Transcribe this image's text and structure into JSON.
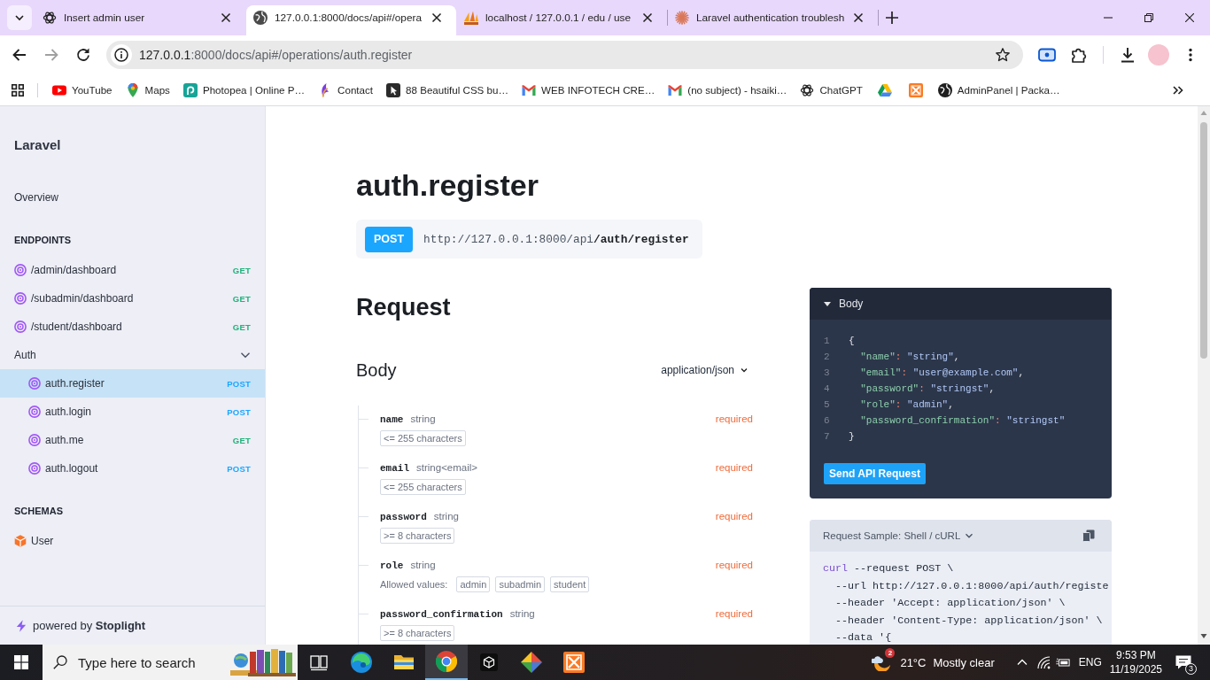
{
  "window": {
    "tabs": [
      {
        "title": "Insert admin user",
        "selected": false
      },
      {
        "title": "127.0.0.1:8000/docs/api#/opera",
        "selected": true
      },
      {
        "title": "localhost / 127.0.0.1 / edu / use",
        "selected": false
      },
      {
        "title": "Laravel authentication troublesh",
        "selected": false
      }
    ]
  },
  "address_bar": {
    "host": "127.0.0.1",
    "path": ":8000/docs/api#/operations/auth.register"
  },
  "bookmarks": [
    {
      "kind": "link",
      "label": "YouTube"
    },
    {
      "kind": "link",
      "label": "Maps"
    },
    {
      "kind": "link",
      "label": "Photopea | Online P…"
    },
    {
      "kind": "link",
      "label": "Contact"
    },
    {
      "kind": "link",
      "label": "88 Beautiful CSS bu…"
    },
    {
      "kind": "link",
      "label": "WEB INFOTECH CRE…"
    },
    {
      "kind": "link",
      "label": "(no subject) - hsaiki…"
    },
    {
      "kind": "link",
      "label": "ChatGPT"
    },
    {
      "kind": "icon"
    },
    {
      "kind": "icon"
    },
    {
      "kind": "link",
      "label": "AdminPanel | Packa…"
    }
  ],
  "sidebar": {
    "title": "Laravel",
    "overview": {
      "label": "Overview",
      "selected": false
    },
    "sections": [
      {
        "heading": "ENDPOINTS",
        "items": [
          {
            "kind": "endpoint",
            "label": "/admin/dashboard",
            "method": "GET",
            "color": "#1eb27a",
            "selected": false
          },
          {
            "kind": "endpoint",
            "label": "/subadmin/dashboard",
            "method": "GET",
            "color": "#1eb27a",
            "selected": false
          },
          {
            "kind": "endpoint",
            "label": "/student/dashboard",
            "method": "GET",
            "color": "#1eb27a",
            "selected": false
          },
          {
            "kind": "group",
            "label": "Auth",
            "expanded": true,
            "selected": false,
            "children": [
              {
                "kind": "endpoint",
                "label": "auth.register",
                "method": "POST",
                "color": "#1aa6ff",
                "selected": true
              },
              {
                "kind": "endpoint",
                "label": "auth.login",
                "method": "POST",
                "color": "#1aa6ff",
                "selected": false
              },
              {
                "kind": "endpoint",
                "label": "auth.me",
                "method": "GET",
                "color": "#1eb27a",
                "selected": false
              },
              {
                "kind": "endpoint",
                "label": "auth.logout",
                "method": "POST",
                "color": "#1aa6ff",
                "selected": false
              }
            ]
          }
        ]
      },
      {
        "heading": "SCHEMAS",
        "items": [
          {
            "kind": "schema",
            "label": "User",
            "selected": false
          }
        ]
      }
    ],
    "footer": "powered by **Stoplight**"
  },
  "operation": {
    "title": "auth.register",
    "method": "POST",
    "base_url": "http://127.0.0.1:8000/api",
    "path": "/auth/register"
  },
  "request": {
    "heading": "Request",
    "body": {
      "heading": "Body",
      "content_type": "application/json",
      "fields": [
        {
          "name": "name",
          "type": "string",
          "required": "required",
          "constraints": [
            "<= 255 characters"
          ]
        },
        {
          "name": "email",
          "type": "string<email>",
          "required": "required",
          "constraints": [
            "<= 255 characters"
          ]
        },
        {
          "name": "password",
          "type": "string",
          "required": "required",
          "constraints": [
            ">= 8 characters"
          ]
        },
        {
          "name": "role",
          "type": "string",
          "required": "required",
          "allowed_values_label": "Allowed values:",
          "allowed_values": [
            "admin",
            "subadmin",
            "student"
          ]
        },
        {
          "name": "password_confirmation",
          "type": "string",
          "required": "required",
          "constraints": [
            ">= 8 characters"
          ]
        }
      ]
    }
  },
  "body_panel": {
    "title": "Body",
    "expanded": true,
    "lines": [
      {
        "number": "1",
        "tokens": [
          {
            "kind": "punctuation",
            "text": "{"
          }
        ]
      },
      {
        "number": "2",
        "tokens": [
          {
            "kind": "key",
            "text": "  \"name\""
          },
          {
            "kind": "operator",
            "text": ": "
          },
          {
            "kind": "string",
            "text": "\"string\""
          },
          {
            "kind": "punctuation",
            "text": ","
          }
        ]
      },
      {
        "number": "3",
        "tokens": [
          {
            "kind": "key",
            "text": "  \"email\""
          },
          {
            "kind": "operator",
            "text": ": "
          },
          {
            "kind": "string",
            "text": "\"user@example.com\""
          },
          {
            "kind": "punctuation",
            "text": ","
          }
        ]
      },
      {
        "number": "4",
        "tokens": [
          {
            "kind": "key",
            "text": "  \"password\""
          },
          {
            "kind": "operator",
            "text": ": "
          },
          {
            "kind": "string",
            "text": "\"stringst\""
          },
          {
            "kind": "punctuation",
            "text": ","
          }
        ]
      },
      {
        "number": "5",
        "tokens": [
          {
            "kind": "key",
            "text": "  \"role\""
          },
          {
            "kind": "operator",
            "text": ": "
          },
          {
            "kind": "string",
            "text": "\"admin\""
          },
          {
            "kind": "punctuation",
            "text": ","
          }
        ]
      },
      {
        "number": "6",
        "tokens": [
          {
            "kind": "key",
            "text": "  \"password_confirmation\""
          },
          {
            "kind": "operator",
            "text": ": "
          },
          {
            "kind": "string",
            "text": "\"stringst\""
          }
        ]
      },
      {
        "number": "7",
        "tokens": [
          {
            "kind": "punctuation",
            "text": "}"
          }
        ]
      }
    ],
    "button": "Send API Request"
  },
  "request_sample": {
    "title": "Request Sample: Shell / cURL",
    "lines": [
      {
        "tokens": [
          {
            "kind": "command",
            "text": "curl"
          },
          {
            "kind": "plain",
            "text": " --request POST \\"
          }
        ]
      },
      {
        "tokens": [
          {
            "kind": "plain",
            "text": "  --url http://127.0.0.1:8000/api/auth/registe"
          }
        ]
      },
      {
        "tokens": [
          {
            "kind": "plain",
            "text": "  --header 'Accept: application/json' \\"
          }
        ]
      },
      {
        "tokens": [
          {
            "kind": "plain",
            "text": "  --header 'Content-Type: application/json' \\"
          }
        ]
      },
      {
        "tokens": [
          {
            "kind": "plain",
            "text": "  --data '{"
          }
        ]
      }
    ]
  },
  "taskbar": {
    "search": {
      "placeholder": "Type here to search"
    },
    "apps": [
      {
        "selected": false
      },
      {
        "selected": false
      },
      {
        "selected": false
      },
      {
        "selected": true
      },
      {
        "selected": false
      },
      {
        "selected": false
      },
      {
        "selected": false
      }
    ],
    "weather": {
      "badge": "2",
      "temperature": "21°C",
      "condition": "Mostly clear"
    },
    "language": "ENG",
    "time": "9:53 PM",
    "date": "11/19/2025",
    "notifications": "3"
  }
}
